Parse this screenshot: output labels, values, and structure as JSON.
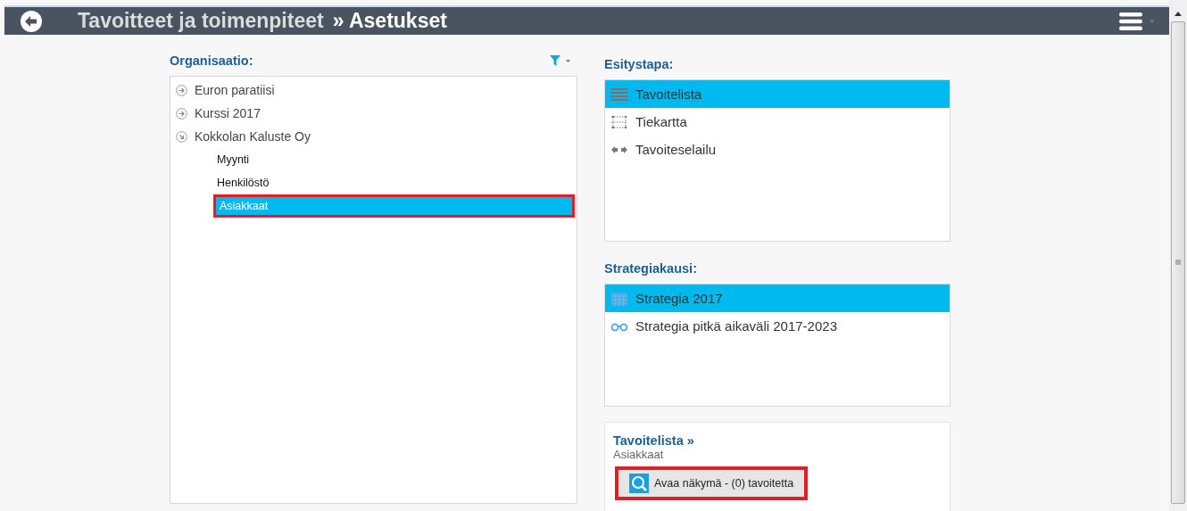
{
  "header": {
    "title": "Tavoitteet ja toimenpiteet",
    "subtitle": "» Asetukset"
  },
  "organisation": {
    "label": "Organisaatio:",
    "tree": [
      {
        "label": "Euron paratiisi",
        "expanded": false,
        "selected": false,
        "annotated": false
      },
      {
        "label": "Kurssi 2017",
        "expanded": false,
        "selected": false,
        "annotated": false
      },
      {
        "label": "Kokkolan Kaluste Oy",
        "expanded": true,
        "selected": false,
        "annotated": false,
        "children": [
          {
            "label": "Myynti",
            "selected": false,
            "annotated": false
          },
          {
            "label": "Henkilöstö",
            "selected": false,
            "annotated": false
          },
          {
            "label": "Asiakkaat",
            "selected": true,
            "annotated": true
          }
        ]
      }
    ]
  },
  "view_mode": {
    "label": "Esitystapa:",
    "items": [
      {
        "kind": "list",
        "label": "Tavoitelista",
        "selected": true
      },
      {
        "kind": "roadmap",
        "label": "Tiekartta",
        "selected": false
      },
      {
        "kind": "browse",
        "label": "Tavoiteselailu",
        "selected": false
      }
    ]
  },
  "strategy_period": {
    "label": "Strategiakausi:",
    "items": [
      {
        "kind": "calendar",
        "label": "Strategia 2017",
        "selected": true
      },
      {
        "kind": "binoculars",
        "label": "Strategia pitkä aikaväli 2017-2023",
        "selected": false
      }
    ]
  },
  "summary": {
    "title": "Tavoitelista »",
    "subtitle": "Asiakkaat",
    "button": {
      "label": "Avaa näkymä - (0) tavoitetta",
      "annotated": true
    }
  }
}
